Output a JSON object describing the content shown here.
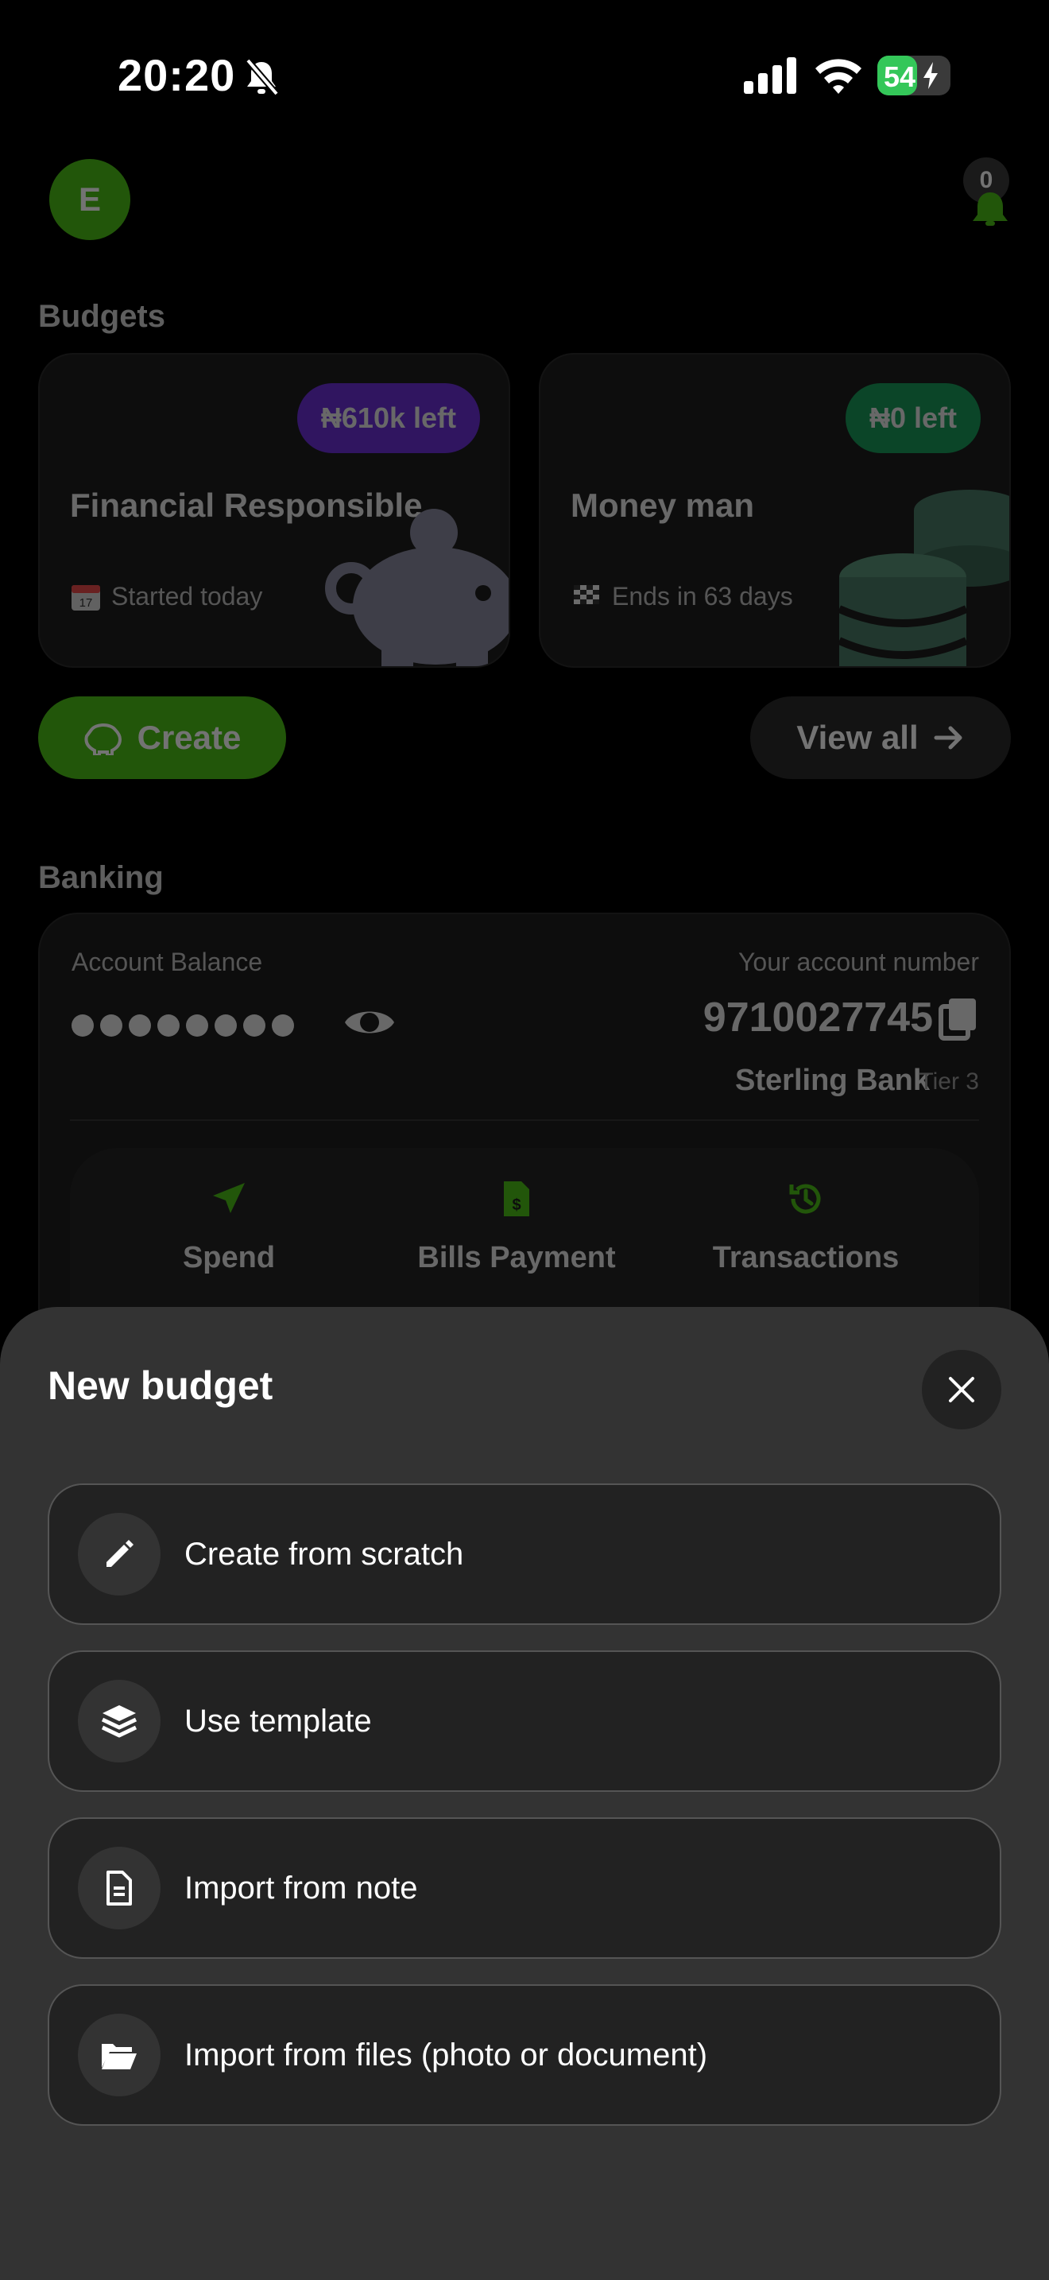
{
  "status_bar": {
    "time": "20:20",
    "battery": "54",
    "battery_level": 0.54
  },
  "header": {
    "avatar_initial": "E",
    "notification_count": "0"
  },
  "budgets": {
    "title": "Budgets",
    "cards": [
      {
        "pill": "₦610k left",
        "name": "Financial Responsible",
        "meta": "Started today",
        "meta_icon": "calendar-icon",
        "pill_color": "#6a2fd6"
      },
      {
        "pill": "₦0 left",
        "name": "Money man",
        "meta": "Ends in 63 days",
        "meta_icon": "checkered-flag-icon",
        "pill_color": "#1a9a5a"
      }
    ],
    "create_label": "Create",
    "view_all_label": "View all"
  },
  "banking": {
    "title": "Banking",
    "balance_label": "Account Balance",
    "balance_masked": "●●●●●●●●",
    "account_number_label": "Your account number",
    "account_number": "9710027745",
    "bank_name": "Sterling Bank",
    "tier": "Tier 3",
    "actions": [
      {
        "label": "Spend",
        "icon": "send-icon"
      },
      {
        "label": "Bills Payment",
        "icon": "bill-icon"
      },
      {
        "label": "Transactions",
        "icon": "history-icon"
      }
    ]
  },
  "sheet": {
    "title": "New budget",
    "options": [
      {
        "label": "Create from scratch",
        "icon": "pencil-icon"
      },
      {
        "label": "Use template",
        "icon": "layers-icon"
      },
      {
        "label": "Import from note",
        "icon": "document-icon"
      },
      {
        "label": "Import from files (photo or document)",
        "icon": "folder-open-icon"
      }
    ]
  },
  "colors": {
    "accent": "#4cbf18",
    "sheet_bg": "#333333",
    "card_bg": "#1d1d1d"
  }
}
